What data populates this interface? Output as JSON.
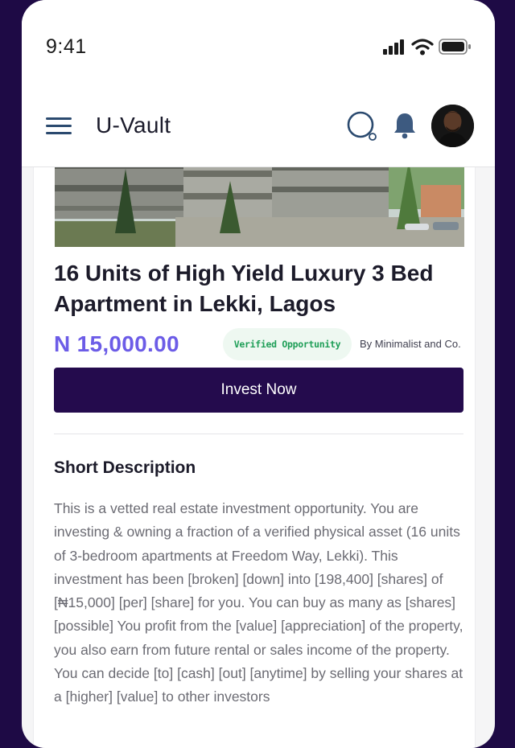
{
  "status_bar": {
    "time": "9:41",
    "icons": [
      "cellular-signal-icon",
      "wifi-icon",
      "battery-icon"
    ]
  },
  "header": {
    "title": "U-Vault",
    "icons": [
      "hamburger-menu-icon",
      "search-icon",
      "notification-bell-icon"
    ],
    "accent_color": "#2b4a6f"
  },
  "listing": {
    "title": "16 Units of High Yield Luxury 3 Bed Apartment in Lekki, Lagos",
    "price": "N 15,000.00",
    "price_color": "#6c5ce7",
    "badge": "Verified Opportunity",
    "badge_color": "#1e9e57",
    "sponsor": "By Minimalist and Co.",
    "cta_label": "Invest Now",
    "cta_color": "#240b4d"
  },
  "description": {
    "heading": "Short Description",
    "body": "This is a vetted real estate investment opportunity. You are investing & owning a fraction of a verified physical asset (16 units of 3-bedroom apartments at Freedom Way, Lekki). This investment has been [broken] [down] into [198,400] [shares] of [₦15,000] [per] [share] for you. You can buy as many as [shares] [possible] You profit from the [value] [appreciation] of the property, you also earn from future rental or sales income of the property. You can decide [to] [cash] [out] [anytime] by selling your shares at a [higher] [value] to other investors"
  }
}
